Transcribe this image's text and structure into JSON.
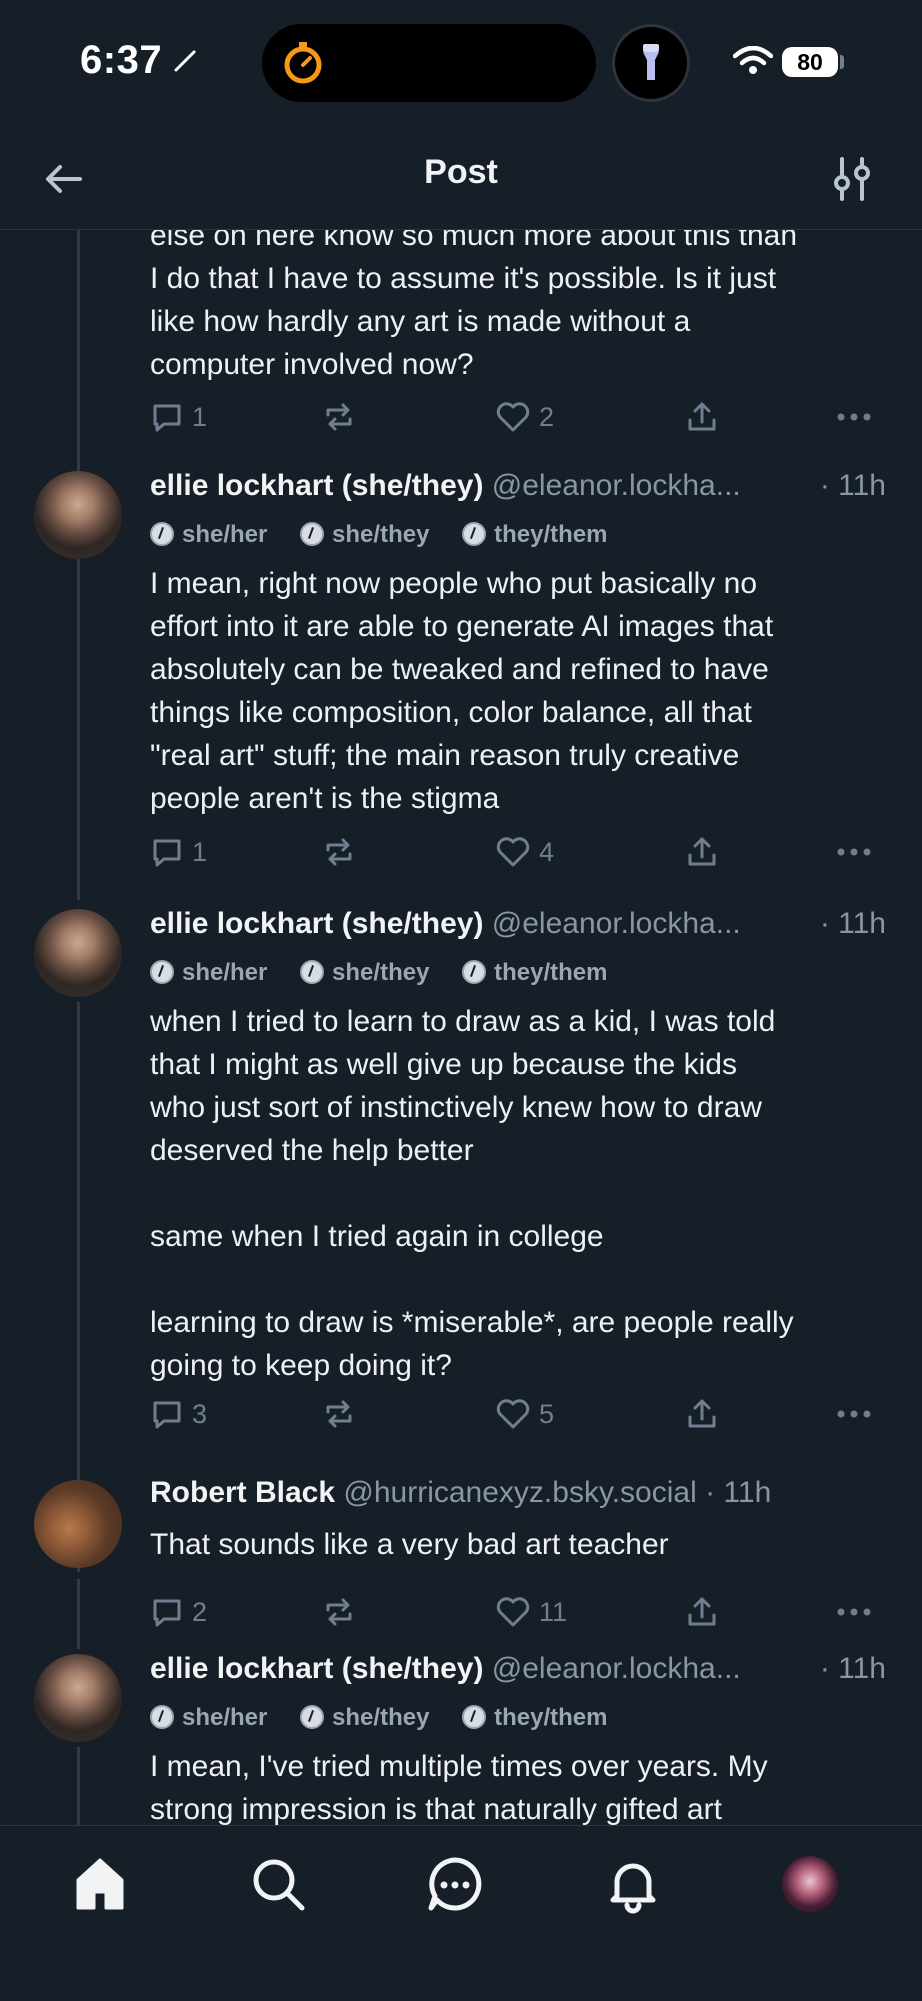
{
  "status_bar": {
    "time": "6:37",
    "battery": "80"
  },
  "header": {
    "title": "Post"
  },
  "posts": [
    {
      "text": "else on here know so much more about this than\nI do that I have to assume it's possible. Is it just\nlike how hardly any art is made without a\ncomputer involved now?",
      "replies": "1",
      "reposts": "",
      "likes": "2"
    },
    {
      "author": "ellie lockhart (she/they)",
      "handle": "@eleanor.lockha...",
      "time": "· 11h",
      "pronouns": [
        "she/her",
        "she/they",
        "they/them"
      ],
      "text": "I mean, right now people who put basically no\neffort into it are able to generate AI images that\nabsolutely can be tweaked and refined to have\nthings like composition, color balance, all that\n\"real art\" stuff; the main reason truly creative\npeople aren't is the stigma",
      "replies": "1",
      "reposts": "",
      "likes": "4"
    },
    {
      "author": "ellie lockhart (she/they)",
      "handle": "@eleanor.lockha...",
      "time": "· 11h",
      "pronouns": [
        "she/her",
        "she/they",
        "they/them"
      ],
      "text": "when I tried to learn to draw as a kid, I was told\nthat I might as well give up because the kids\nwho just sort of instinctively knew how to draw\ndeserved the help better\n\nsame when I tried again in college\n\nlearning to draw is *miserable*, are people really\ngoing to keep doing it?",
      "replies": "3",
      "reposts": "",
      "likes": "5"
    },
    {
      "author": "Robert Black",
      "handle": "@hurricanexyz.bsky.social",
      "time": "· 11h",
      "text": "That sounds like a very bad art teacher",
      "replies": "2",
      "reposts": "",
      "likes": "11"
    },
    {
      "author": "ellie lockhart (she/they)",
      "handle": "@eleanor.lockha...",
      "time": "· 11h",
      "pronouns": [
        "she/her",
        "she/they",
        "they/them"
      ],
      "text": "I mean, I've tried multiple times over years. My\nstrong impression is that naturally gifted art"
    }
  ],
  "tabbar": {
    "items": [
      "home-icon",
      "search-icon",
      "chat-icon",
      "bell-icon",
      "profile-avatar"
    ]
  }
}
